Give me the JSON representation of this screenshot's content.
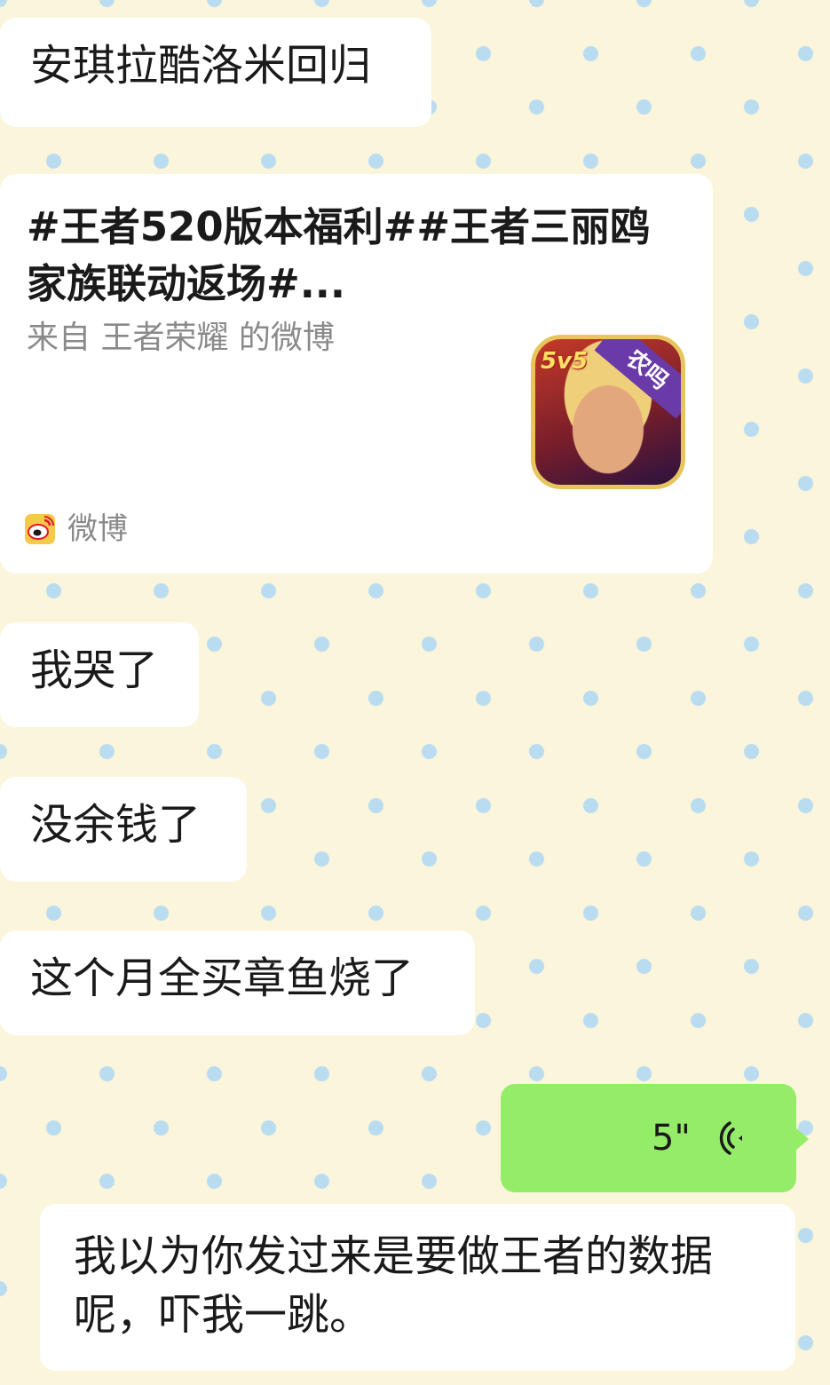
{
  "messages": {
    "m1": "安琪拉酷洛米回归",
    "card": {
      "title": "#王者520版本福利##王者三丽鸥家族联动返场#...",
      "source": "来自 王者荣耀 的微博",
      "app_badge": "5v5",
      "app_ribbon": "农吗",
      "footer_label": "微博",
      "footer_icon": "weibo-icon"
    },
    "m2": "我哭了",
    "m3": "没余钱了",
    "m4": "这个月全买章鱼烧了",
    "voice": {
      "duration": "5\"",
      "icon": "voice-wave-icon",
      "color": "#95ec69"
    },
    "reply": "我以为你发过来是要做王者的数据呢，吓我一跳。"
  },
  "colors": {
    "background": "#fbf5dc",
    "dots": "#b9dcf0",
    "bubble": "#ffffff",
    "secondary_text": "#8a8a8a"
  }
}
